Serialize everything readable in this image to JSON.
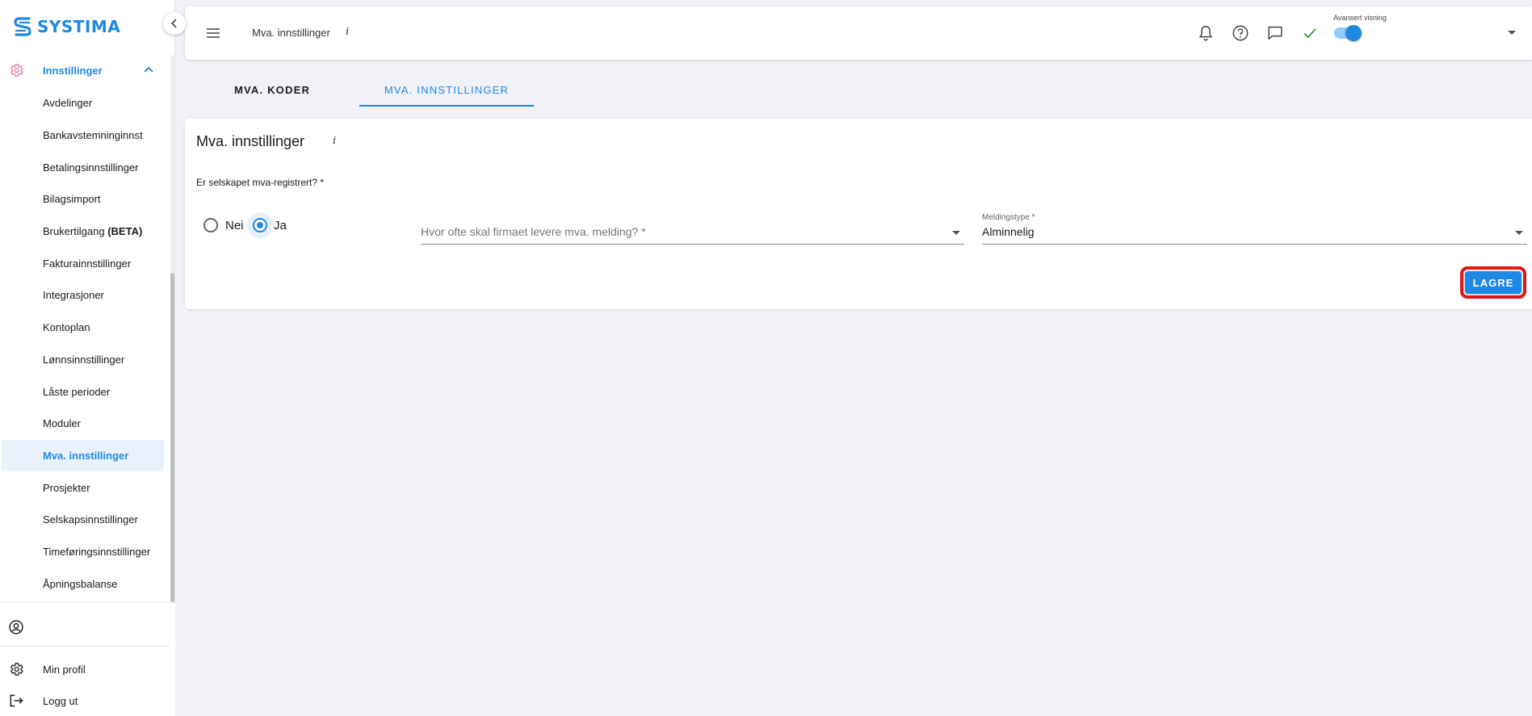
{
  "app": {
    "logo_text": "SYSTIMA",
    "brand_color": "#1e88e5",
    "alert_color": "#e0161b"
  },
  "sidebar": {
    "section_label": "Innstillinger",
    "items": [
      {
        "label": "Avdelinger",
        "active": false
      },
      {
        "label": "Bankavstemninginnst",
        "active": false
      },
      {
        "label": "Betalingsinnstillinger",
        "active": false
      },
      {
        "label": "Bilagsimport",
        "active": false
      },
      {
        "label": "Brukertilgang ",
        "label_bold": "(BETA)",
        "active": false
      },
      {
        "label": "Fakturainnstillinger",
        "active": false
      },
      {
        "label": "Integrasjoner",
        "active": false
      },
      {
        "label": "Kontoplan",
        "active": false
      },
      {
        "label": "Lønnsinnstillinger",
        "active": false
      },
      {
        "label": "Låste perioder",
        "active": false
      },
      {
        "label": "Moduler",
        "active": false
      },
      {
        "label": "Mva. innstillinger",
        "active": true
      },
      {
        "label": "Prosjekter",
        "active": false
      },
      {
        "label": "Selskapsinnstillinger",
        "active": false
      },
      {
        "label": "Timeføringsinnstillinger",
        "active": false
      },
      {
        "label": "Åpningsbalanse",
        "active": false
      }
    ],
    "bottom": {
      "profile_label": "Min profil",
      "logout_label": "Logg ut"
    }
  },
  "topbar": {
    "title": "Mva. innstillinger",
    "info_glyph": "i",
    "toggle_label": "Avansert visning",
    "toggle_on": true,
    "icons": [
      "bell-icon",
      "help-icon",
      "chat-icon",
      "check-icon"
    ]
  },
  "tabs": [
    {
      "label": "MVA. KODER",
      "active": false
    },
    {
      "label": "MVA. INNSTILLINGER",
      "active": true
    }
  ],
  "card": {
    "title": "Mva. innstillinger",
    "info_glyph": "i",
    "question": "Er selskapet mva-registrert? *",
    "radio_no_label": "Nei",
    "radio_yes_label": "Ja",
    "selected": "Ja",
    "frequency_placeholder": "Hvor ofte skal firmaet levere mva. melding? *",
    "message_type_label": "Meldingstype *",
    "message_type_value": "Alminnelig",
    "save_label": "LAGRE"
  }
}
